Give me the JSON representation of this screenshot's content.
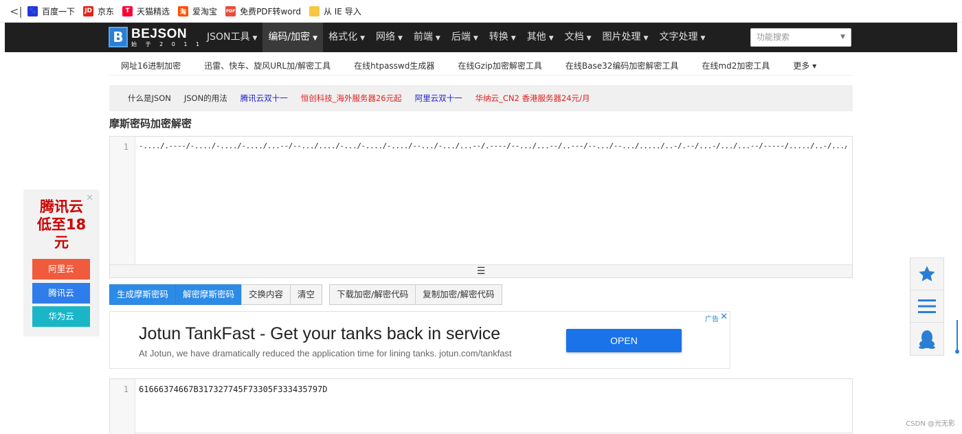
{
  "bookmarks": [
    {
      "label": "百度一下",
      "icon": "baidu-paw-icon",
      "color": "#2932e1",
      "glyph": "🐾"
    },
    {
      "label": "京东",
      "icon": "jd-icon",
      "color": "#e1251b",
      "glyph": "JD"
    },
    {
      "label": "天猫精选",
      "icon": "tmall-icon",
      "color": "#ff0036",
      "glyph": "T"
    },
    {
      "label": "爱淘宝",
      "icon": "taobao-icon",
      "color": "#ff5000",
      "glyph": "淘"
    },
    {
      "label": "免费PDF转word",
      "icon": "pdf-icon",
      "color": "#e84c3d",
      "glyph": "PDF"
    },
    {
      "label": "从 IE 导入",
      "icon": "folder-icon",
      "color": "#f5c742",
      "glyph": ""
    }
  ],
  "logo": {
    "title": "BEJSON",
    "sub": "始 于 2 0 1 1",
    "mark": "B"
  },
  "nav": [
    {
      "label": "JSON工具"
    },
    {
      "label": "编码/加密"
    },
    {
      "label": "格式化"
    },
    {
      "label": "网络"
    },
    {
      "label": "前端"
    },
    {
      "label": "后端"
    },
    {
      "label": "转换"
    },
    {
      "label": "其他"
    },
    {
      "label": "文档"
    },
    {
      "label": "图片处理"
    },
    {
      "label": "文字处理"
    }
  ],
  "search": {
    "placeholder": "功能搜索"
  },
  "subnav": [
    "网址16进制加密",
    "迅雷、快车、旋风URL加/解密工具",
    "在线htpasswd生成器",
    "在线Gzip加密解密工具",
    "在线Base32编码加密解密工具",
    "在线md2加密工具",
    "更多"
  ],
  "links": [
    {
      "label": "什么是JSON",
      "color": "#333333"
    },
    {
      "label": "JSON的用法",
      "color": "#333333"
    },
    {
      "label": "腾讯云双十一",
      "color": "#1a1acd"
    },
    {
      "label": "恒创科技_海外服务器26元起",
      "color": "#e02020"
    },
    {
      "label": "阿里云双十一",
      "color": "#1a1acd"
    },
    {
      "label": "华纳云_CN2 香港服务器24元/月",
      "color": "#e02020"
    }
  ],
  "page_title": "摩斯密码加密解密",
  "input_editor": {
    "line": "1",
    "content": "-..../.----/-..../-..../-..../...--/--.../..../-.../-..../-..../--.../-.../...--/.----/--.../...--/..---/--.../--.../...../..-/.--/...-/.../...--/-----/...../..-/.../...--/...--/...--/.....-/...--/...../--.../....-/--.../-.."
  },
  "buttons": [
    "生成摩斯密码",
    "解密摩斯密码",
    "交换内容",
    "清空",
    "下载加密/解密代码",
    "复制加密/解密代码"
  ],
  "ad": {
    "title": "Jotun TankFast - Get your tanks back in service",
    "desc": "At Jotun, we have dramatically reduced the application time for lining tanks. jotun.com/tankfast",
    "button": "OPEN",
    "tag": "广告",
    "close": "✕"
  },
  "output_editor": {
    "line": "1",
    "content": "61666374667B317327745F73305F333435797D"
  },
  "side_ad": {
    "title": "腾讯云低至18元",
    "buttons": [
      {
        "label": "阿里云",
        "color": "#ef5b3c"
      },
      {
        "label": "腾讯云",
        "color": "#2f7deb"
      },
      {
        "label": "华为云",
        "color": "#1ab6c8"
      }
    ]
  },
  "watermark": "CSDN @光无影",
  "colors": {
    "nav_bg": "#1f1f1f",
    "primary": "#2d8be8",
    "accent_blue": "#2a7fd4"
  }
}
